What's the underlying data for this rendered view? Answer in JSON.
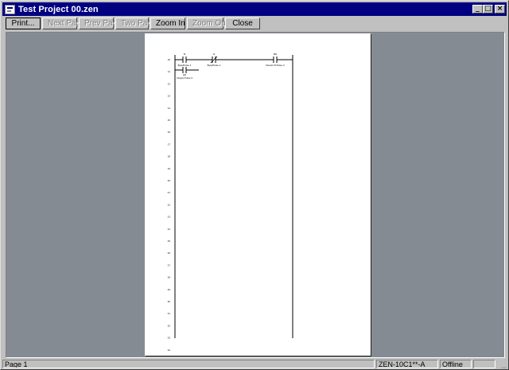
{
  "window": {
    "title": "Test Project 00.zen",
    "minimize_glyph": "_",
    "maximize_glyph": "□",
    "close_glyph": "×"
  },
  "toolbar": {
    "print_label": "Print...",
    "next_page_label": "Next Page",
    "prev_page_label": "Prev Page",
    "two_page_label": "Two Page",
    "zoom_in_label": "Zoom In",
    "zoom_out_label": "Zoom Out",
    "close_label": "Close"
  },
  "ladder": {
    "contacts": [
      {
        "address": "I0",
        "comment": "Byte/Pulse 1"
      },
      {
        "address": "I1",
        "comment": "Byte/Pulse 1"
      },
      {
        "address": "Q0",
        "comment": "Output Pulse 3"
      }
    ],
    "coil": {
      "address": "M0",
      "comment": "Result Of Pulse 3"
    },
    "rung_numbers": [
      "10",
      "11",
      "12",
      "13",
      "14",
      "15",
      "16",
      "17",
      "18",
      "19",
      "20",
      "21",
      "22",
      "23",
      "24",
      "25",
      "26",
      "27",
      "28",
      "29",
      "30",
      "31",
      "32",
      "33",
      "34",
      "35"
    ]
  },
  "statusbar": {
    "page": "Page 1",
    "model": "ZEN-10C1**-A",
    "mode": "Offline",
    "extra": ""
  }
}
